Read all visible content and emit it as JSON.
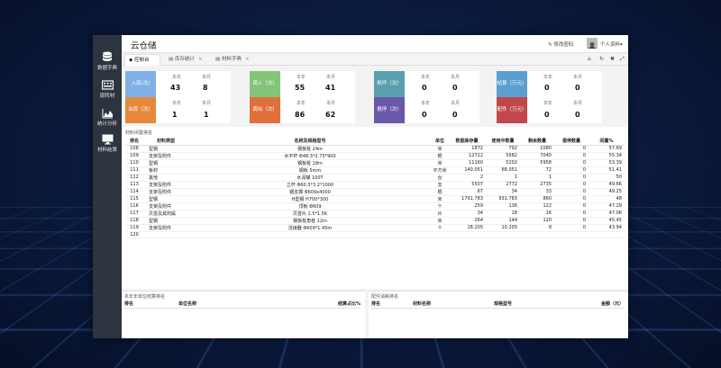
{
  "app": {
    "title": "云仓储"
  },
  "header": {
    "change_password": "修改密码",
    "profile": "个人资料"
  },
  "sidebar": {
    "items": [
      {
        "label": "数据字典",
        "icon": "database-icon"
      },
      {
        "label": "周转材",
        "icon": "keyboard-icon"
      },
      {
        "label": "统计分析",
        "icon": "area-chart-icon"
      },
      {
        "label": "材料结算",
        "icon": "monitor-icon"
      }
    ]
  },
  "tabs": [
    {
      "label": "控制台",
      "icon": "diamond-icon",
      "closable": false,
      "active": true
    },
    {
      "label": "库存统计",
      "icon": "table-icon",
      "closable": true,
      "active": false
    },
    {
      "label": "材料字典",
      "icon": "table-icon",
      "closable": true,
      "active": false
    }
  ],
  "cards": [
    {
      "rows": [
        {
          "label": "入库(次)",
          "color": "#7fb0e6",
          "year_label": "本年",
          "month_label": "本月",
          "year": "43",
          "month": "8"
        },
        {
          "label": "出库（次）",
          "color": "#e6893b",
          "year_label": "本年",
          "month_label": "本月",
          "year": "1",
          "month": "1"
        }
      ]
    },
    {
      "rows": [
        {
          "label": "调入（次）",
          "color": "#84c47a",
          "year_label": "本年",
          "month_label": "本月",
          "year": "55",
          "month": "41"
        },
        {
          "label": "调出（次）",
          "color": "#e0703a",
          "year_label": "本年",
          "month_label": "本月",
          "year": "86",
          "month": "62"
        }
      ]
    },
    {
      "rows": [
        {
          "label": "损坏（次）",
          "color": "#5a9fb0",
          "year_label": "本年",
          "month_label": "本月",
          "year": "0",
          "month": "0"
        },
        {
          "label": "报停（次）",
          "color": "#6a58a8",
          "year_label": "本年",
          "month_label": "本月",
          "year": "0",
          "month": "0"
        }
      ]
    },
    {
      "rows": [
        {
          "label": "结算（万元）",
          "color": "#5a9fcf",
          "year_label": "本年",
          "month_label": "本月",
          "year": "0",
          "month": "0"
        },
        {
          "label": "配件（万元）",
          "color": "#c0484c",
          "year_label": "本年",
          "month_label": "本月",
          "year": "0",
          "month": "0"
        }
      ]
    }
  ],
  "idle_table": {
    "title": "材料闲置排名",
    "columns": [
      "排名",
      "材料类型",
      "名称及规格型号",
      "单位",
      "数据库存量",
      "使用中数量",
      "剩余数量",
      "报停数量",
      "闲置%"
    ],
    "rows": [
      [
        "108",
        "型钢",
        "钢板桩 24m",
        "米",
        "1872",
        "792",
        "1080",
        "0",
        "57.69"
      ],
      [
        "109",
        "支架及附件",
        "水平杆 Φ48.3*2.75*900",
        "根",
        "12722",
        "5682",
        "7040",
        "0",
        "55.34"
      ],
      [
        "110",
        "型钢",
        "钢板桩 18m",
        "米",
        "11160",
        "5202",
        "5958",
        "0",
        "53.39"
      ],
      [
        "111",
        "板材",
        "钢板 5mm",
        "平方米",
        "140.051",
        "68.051",
        "72",
        "0",
        "51.41"
      ],
      [
        "112",
        "其他",
        "水泥罐 100T",
        "台",
        "2",
        "1",
        "1",
        "0",
        "50"
      ],
      [
        "113",
        "支架及附件",
        "立杆 Φ60.3*3.2*1000",
        "支",
        "5507",
        "2772",
        "2735",
        "0",
        "49.66"
      ],
      [
        "114",
        "支架及附件",
        "钢支撑 Φ609x4000",
        "根",
        "67",
        "34",
        "33",
        "0",
        "49.25"
      ],
      [
        "115",
        "型钢",
        "H型钢 H700*300",
        "米",
        "1791.783",
        "931.783",
        "860",
        "0",
        "48"
      ],
      [
        "116",
        "支架及附件",
        "顶板 Φ609",
        "个",
        "259",
        "136",
        "122",
        "0",
        "47.29"
      ],
      [
        "117",
        "贝雷及其附属",
        "贝雷片 1.5*1.5K",
        "片",
        "34",
        "18",
        "16",
        "0",
        "47.06"
      ],
      [
        "118",
        "型钢",
        "钢板桩角桩 12m",
        "米",
        "264",
        "144",
        "120",
        "0",
        "45.45"
      ],
      [
        "119",
        "支架及附件",
        "活接器 Φ609*1.45m",
        "个",
        "18.205",
        "10.205",
        "8",
        "0",
        "43.94"
      ],
      [
        "120",
        "",
        "",
        "",
        "",
        "",
        "",
        "",
        ""
      ]
    ]
  },
  "month_unit_table": {
    "title": "本年年单位结算排名",
    "columns": [
      "排名",
      "单位名称",
      "结算占比%"
    ]
  },
  "parts_table": {
    "title": "配件消耗排名",
    "columns": [
      "排名",
      "材料名称",
      "规格型号",
      "金额（元）"
    ]
  },
  "colors": {
    "sidebar_bg": "#2c3440",
    "accent_active_tab": "#ffffff"
  }
}
